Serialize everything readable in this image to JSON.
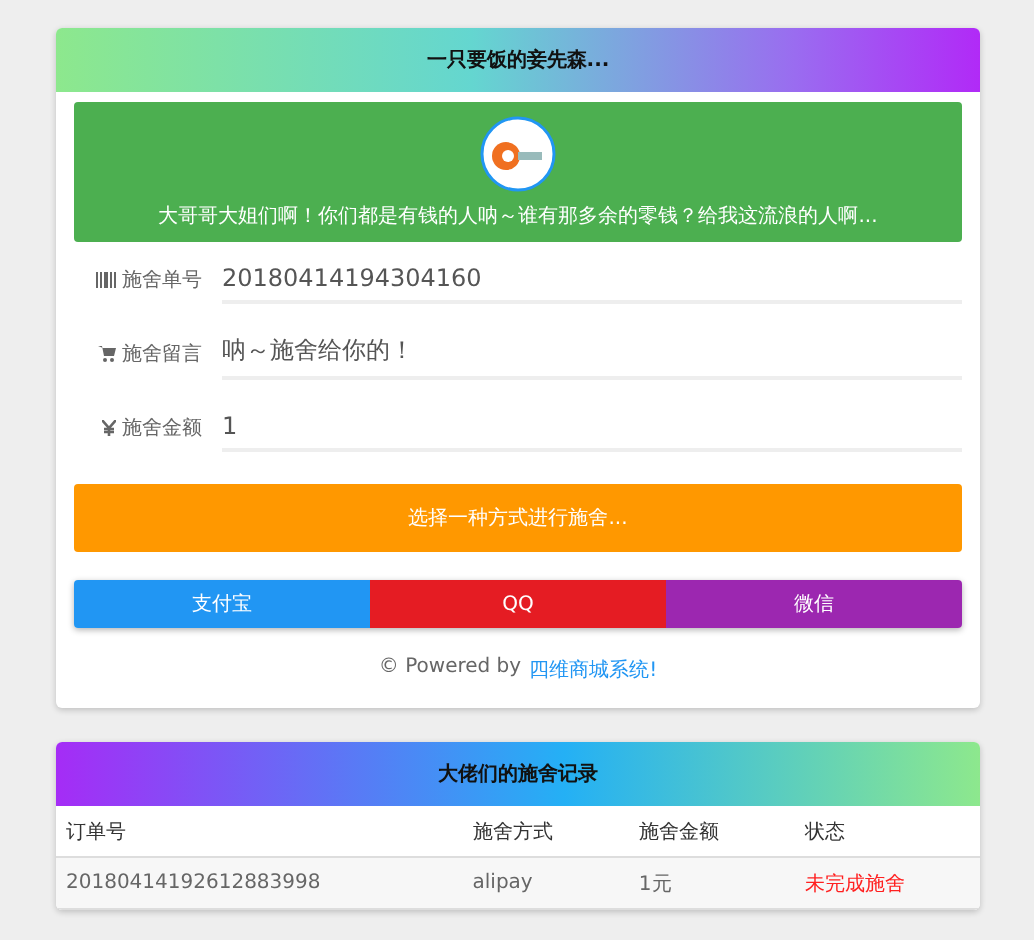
{
  "header": {
    "title": "一只要饭的妾先森..."
  },
  "banner": {
    "message": "大哥哥大姐们啊！你们都是有钱的人呐～谁有那多余的零钱？给我这流浪的人啊..."
  },
  "fields": [
    {
      "kind": "order",
      "label": "施舍单号",
      "value": "20180414194304160"
    },
    {
      "kind": "message",
      "label": "施舍留言",
      "value": "呐～施舍给你的！"
    },
    {
      "kind": "amount",
      "label": "施舍金额",
      "value": "1"
    }
  ],
  "choose_button": "选择一种方式进行施舍...",
  "payment_buttons": [
    {
      "label": "支付宝",
      "color": "#2196f3"
    },
    {
      "label": "QQ",
      "color": "#e51c23"
    },
    {
      "label": "微信",
      "color": "#9c27b0"
    }
  ],
  "footer": {
    "text": "© Powered by",
    "link": "四维商城系统!"
  },
  "records": {
    "title": "大佬们的施舍记录",
    "columns": [
      "订单号",
      "施舍方式",
      "施舍金额",
      "状态"
    ],
    "rows": [
      {
        "order": "20180414192612883998",
        "method": "alipay",
        "amount": "1元",
        "status": "未完成施舍"
      }
    ]
  }
}
